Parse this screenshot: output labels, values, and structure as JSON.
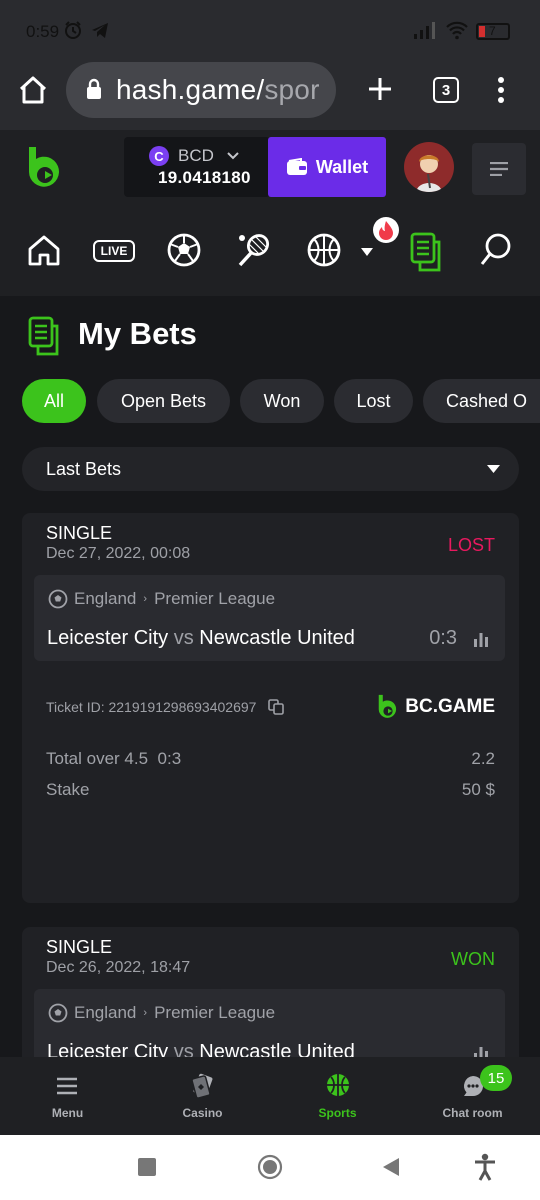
{
  "status_bar": {
    "time": "0:59",
    "battery_level": "7"
  },
  "browser": {
    "url_host": "hash.game/",
    "url_path": "spor",
    "tab_count": "3"
  },
  "header": {
    "currency": "BCD",
    "balance": "19.0418180",
    "wallet_label": "Wallet"
  },
  "page": {
    "title": "My Bets"
  },
  "filters": {
    "tabs": [
      "All",
      "Open Bets",
      "Won",
      "Lost",
      "Cashed O"
    ],
    "active": "All"
  },
  "sort": {
    "selected": "Last Bets"
  },
  "bets": [
    {
      "type": "SINGLE",
      "date": "Dec 27, 2022, 00:08",
      "status": "LOST",
      "status_color": "#e8195f",
      "country": "England",
      "league": "Premier League",
      "home": "Leicester City",
      "vs": "vs",
      "away": "Newcastle United",
      "score": "0:3",
      "ticket_id": "Ticket ID: 2219191298693402697",
      "brand": "BC.GAME",
      "market": "Total over 4.5",
      "market_score": "0:3",
      "odds": "2.2",
      "stake_label": "Stake",
      "stake": "50 $"
    },
    {
      "type": "SINGLE",
      "date": "Dec 26, 2022, 18:47",
      "status": "WON",
      "status_color": "#3cc31c",
      "country": "England",
      "league": "Premier League",
      "home": "Leicester City",
      "vs": "vs",
      "away": "Newcastle United"
    }
  ],
  "bottom_nav": {
    "menu": "Menu",
    "casino": "Casino",
    "sports": "Sports",
    "chat": "Chat room",
    "chat_badge": "15"
  },
  "colors": {
    "accent_green": "#3cc31c",
    "wallet_purple": "#6b2ce8",
    "lost_red": "#e8195f"
  }
}
